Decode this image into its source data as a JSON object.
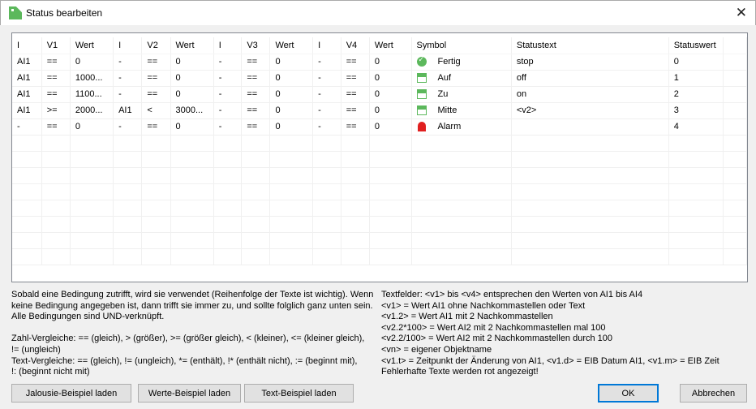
{
  "window": {
    "title": "Status bearbeiten",
    "close": "✕"
  },
  "table": {
    "headers": [
      "I",
      "V1",
      "Wert",
      "I",
      "V2",
      "Wert",
      "I",
      "V3",
      "Wert",
      "I",
      "V4",
      "Wert",
      "Symbol",
      "Statustext",
      "Statuswert"
    ],
    "rows": [
      {
        "cells": [
          "AI1",
          "==",
          "0",
          "-",
          "==",
          "0",
          "-",
          "==",
          "0",
          "-",
          "==",
          "0"
        ],
        "symbol_icon": "check-circle-icon",
        "symbol": "Fertig",
        "statustext": "stop",
        "statuswert": "0"
      },
      {
        "cells": [
          "AI1",
          "==",
          "1000...",
          "-",
          "==",
          "0",
          "-",
          "==",
          "0",
          "-",
          "==",
          "0"
        ],
        "symbol_icon": "blind-up-icon",
        "symbol": "Auf",
        "statustext": "off",
        "statuswert": "1"
      },
      {
        "cells": [
          "AI1",
          "==",
          "1100...",
          "-",
          "==",
          "0",
          "-",
          "==",
          "0",
          "-",
          "==",
          "0"
        ],
        "symbol_icon": "blind-down-icon",
        "symbol": "Zu",
        "statustext": "on",
        "statuswert": "2"
      },
      {
        "cells": [
          "AI1",
          ">=",
          "2000...",
          "AI1",
          "<",
          "3000...",
          "-",
          "==",
          "0",
          "-",
          "==",
          "0"
        ],
        "symbol_icon": "blind-middle-icon",
        "symbol": "Mitte",
        "statustext": "<v2>",
        "statuswert": "3"
      },
      {
        "cells": [
          "-",
          "==",
          "0",
          "-",
          "==",
          "0",
          "-",
          "==",
          "0",
          "-",
          "==",
          "0"
        ],
        "symbol_icon": "alarm-icon",
        "symbol": "Alarm",
        "statustext": "",
        "statuswert": "4"
      }
    ]
  },
  "help_left": [
    "Sobald eine Bedingung zutrifft, wird sie verwendet (Reihenfolge der Texte ist wichtig). Wenn",
    "keine Bedingung angegeben ist, dann trifft sie immer zu, und sollte folglich ganz unten sein.",
    "Alle Bedingungen sind UND-verknüpft.",
    "",
    "Zahl-Vergleiche: == (gleich), > (größer), >= (größer gleich), < (kleiner), <= (kleiner gleich),",
    "!= (ungleich)",
    "Text-Vergleiche: == (gleich), != (ungleich), *= (enthält), !* (enthält nicht), := (beginnt mit),",
    "!: (beginnt nicht mit)"
  ],
  "help_right": [
    "Textfelder: <v1> bis <v4> entsprechen den Werten von AI1 bis AI4",
    "<v1> = Wert AI1 ohne Nachkommastellen oder Text",
    "<v1.2> = Wert AI1 mit 2 Nachkommastellen",
    "<v2.2*100> = Wert AI2 mit 2 Nachkommastellen mal 100",
    "<v2.2/100> = Wert AI2 mit 2 Nachkommastellen durch 100",
    "<vn> = eigener Objektname",
    "<v1.t> = Zeitpunkt der Änderung von AI1, <v1.d> = EIB Datum AI1, <v1.m> = EIB Zeit",
    "Fehlerhafte Texte werden rot angezeigt!"
  ],
  "buttons": {
    "jalousie": "Jalousie-Beispiel laden",
    "werte": "Werte-Beispiel laden",
    "text": "Text-Beispiel laden",
    "ok": "OK",
    "cancel": "Abbrechen"
  }
}
